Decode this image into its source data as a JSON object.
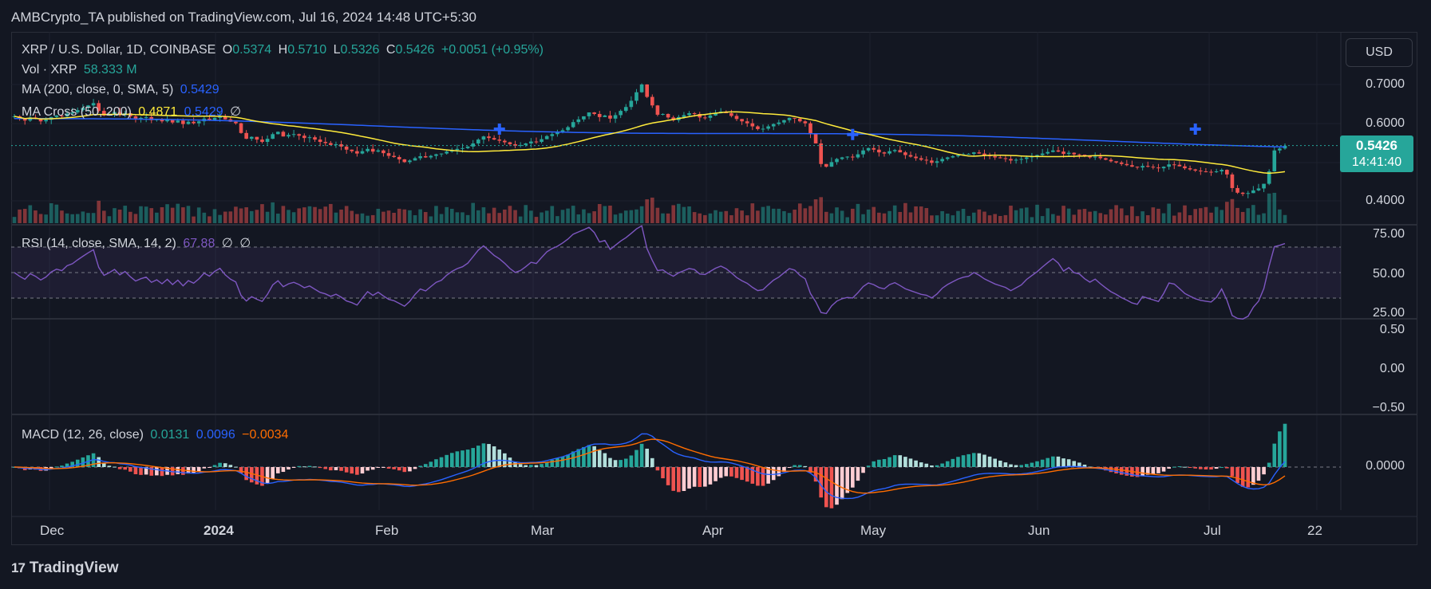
{
  "header": {
    "publisher_line": "AMBCrypto_TA published on TradingView.com, Jul 16, 2024 14:48 UTC+5:30"
  },
  "symbol": {
    "name": "XRP / U.S. Dollar, 1D, COINBASE",
    "o_label": "O",
    "o": "0.5374",
    "h_label": "H",
    "h": "0.5710",
    "l_label": "L",
    "l": "0.5326",
    "c_label": "C",
    "c": "0.5426",
    "change": "+0.0051 (+0.95%)"
  },
  "volume": {
    "label": "Vol · XRP",
    "value": "58.333 M"
  },
  "ma": {
    "label": "MA (200, close, 0, SMA, 5)",
    "value": "0.5429"
  },
  "ma_cross": {
    "label": "MA Cross (50, 200)",
    "v1": "0.4871",
    "v2": "0.5429",
    "v3": "∅"
  },
  "rsi": {
    "label": "RSI (14, close, SMA, 14, 2)",
    "value": "67.88",
    "v2": "∅",
    "v3": "∅"
  },
  "macd": {
    "label": "MACD (12, 26, close)",
    "macd": "0.0131",
    "signal": "0.0096",
    "hist": "−0.0034"
  },
  "currency_button": "USD",
  "last_price": {
    "price": "0.5426",
    "countdown": "14:41:40"
  },
  "price_axis": [
    "0.7000",
    "0.6000",
    "0.4000"
  ],
  "rsi_axis": [
    "75.00",
    "50.00",
    "25.00"
  ],
  "osc_axis": [
    "0.50",
    "0.00",
    "−0.50"
  ],
  "macd_axis": [
    "0.0000"
  ],
  "time_axis": [
    "Dec",
    "2024",
    "Feb",
    "Mar",
    "Apr",
    "May",
    "Jun",
    "Jul",
    "22"
  ],
  "brand": {
    "name": "TradingView",
    "mark": "17"
  },
  "colors": {
    "up": "#26a69a",
    "down": "#ef5350",
    "ma200": "#2962ff",
    "ma50": "#ffeb3b",
    "rsi": "#7e57c2",
    "macd_signal": "#ff6d00"
  },
  "chart_data": {
    "type": "candlestick",
    "symbol": "XRP / U.S. Dollar, 1D, COINBASE",
    "ylim": [
      0.38,
      0.74
    ],
    "rsi_levels": [
      70,
      50,
      30
    ],
    "close": [
      0.618,
      0.612,
      0.607,
      0.615,
      0.611,
      0.605,
      0.609,
      0.616,
      0.62,
      0.618,
      0.625,
      0.628,
      0.634,
      0.64,
      0.646,
      0.652,
      0.632,
      0.62,
      0.624,
      0.629,
      0.621,
      0.626,
      0.618,
      0.611,
      0.614,
      0.616,
      0.608,
      0.611,
      0.605,
      0.61,
      0.602,
      0.607,
      0.598,
      0.604,
      0.6,
      0.605,
      0.612,
      0.608,
      0.614,
      0.618,
      0.61,
      0.604,
      0.6,
      0.575,
      0.56,
      0.565,
      0.558,
      0.552,
      0.56,
      0.572,
      0.578,
      0.566,
      0.57,
      0.572,
      0.568,
      0.562,
      0.564,
      0.558,
      0.552,
      0.549,
      0.544,
      0.546,
      0.54,
      0.532,
      0.528,
      0.522,
      0.528,
      0.534,
      0.527,
      0.53,
      0.523,
      0.516,
      0.513,
      0.507,
      0.5,
      0.504,
      0.51,
      0.515,
      0.512,
      0.516,
      0.52,
      0.522,
      0.527,
      0.531,
      0.534,
      0.536,
      0.54,
      0.548,
      0.558,
      0.566,
      0.562,
      0.558,
      0.555,
      0.551,
      0.546,
      0.542,
      0.544,
      0.548,
      0.553,
      0.552,
      0.559,
      0.567,
      0.572,
      0.576,
      0.582,
      0.59,
      0.603,
      0.61,
      0.618,
      0.628,
      0.624,
      0.616,
      0.62,
      0.612,
      0.621,
      0.632,
      0.642,
      0.658,
      0.68,
      0.7,
      0.668,
      0.646,
      0.622,
      0.624,
      0.615,
      0.608,
      0.616,
      0.621,
      0.626,
      0.624,
      0.615,
      0.614,
      0.62,
      0.626,
      0.63,
      0.626,
      0.619,
      0.611,
      0.605,
      0.6,
      0.592,
      0.585,
      0.586,
      0.592,
      0.598,
      0.602,
      0.608,
      0.614,
      0.612,
      0.605,
      0.6,
      0.572,
      0.548,
      0.495,
      0.488,
      0.5,
      0.508,
      0.512,
      0.514,
      0.512,
      0.52,
      0.53,
      0.536,
      0.532,
      0.525,
      0.522,
      0.528,
      0.531,
      0.525,
      0.518,
      0.514,
      0.51,
      0.506,
      0.504,
      0.498,
      0.502,
      0.508,
      0.512,
      0.515,
      0.518,
      0.52,
      0.521,
      0.525,
      0.522,
      0.518,
      0.515,
      0.512,
      0.51,
      0.508,
      0.504,
      0.506,
      0.508,
      0.512,
      0.515,
      0.518,
      0.522,
      0.526,
      0.53,
      0.527,
      0.521,
      0.524,
      0.52,
      0.519,
      0.515,
      0.512,
      0.514,
      0.51,
      0.506,
      0.502,
      0.499,
      0.495,
      0.492,
      0.488,
      0.486,
      0.49,
      0.488,
      0.486,
      0.484,
      0.488,
      0.494,
      0.493,
      0.489,
      0.484,
      0.481,
      0.478,
      0.476,
      0.475,
      0.474,
      0.476,
      0.48,
      0.468,
      0.433,
      0.421,
      0.418,
      0.42,
      0.427,
      0.432,
      0.444,
      0.476,
      0.53,
      0.535,
      0.542
    ]
  }
}
